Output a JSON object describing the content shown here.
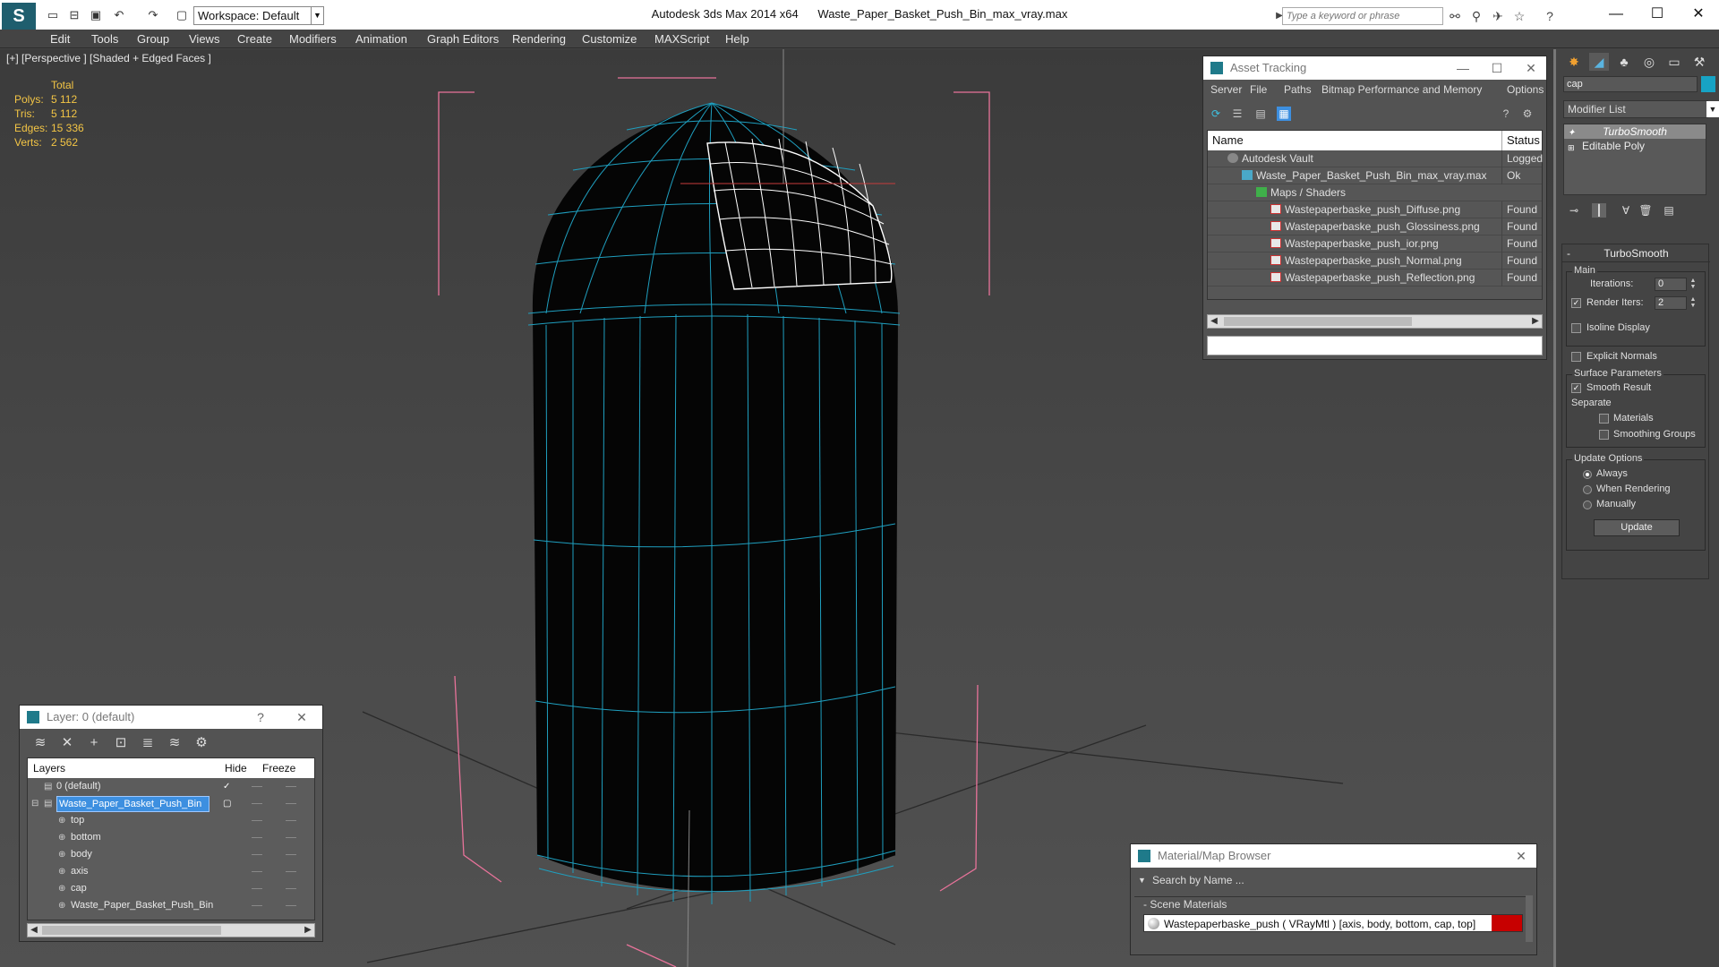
{
  "titlebar": {
    "app_title": "Autodesk 3ds Max  2014 x64",
    "file_title": "Waste_Paper_Basket_Push_Bin_max_vray.max",
    "workspace": "Workspace: Default",
    "search_placeholder": "Type a keyword or phrase"
  },
  "menu": [
    "Edit",
    "Tools",
    "Group",
    "Views",
    "Create",
    "Modifiers",
    "Animation",
    "Graph Editors",
    "Rendering",
    "Customize",
    "MAXScript",
    "Help"
  ],
  "viewport": {
    "label": "[+] [Perspective ] [Shaded + Edged Faces ]",
    "stats_header": "Total",
    "stats": [
      {
        "k": "Polys:",
        "v": "5 112"
      },
      {
        "k": "Tris:",
        "v": "5 112"
      },
      {
        "k": "Edges:",
        "v": "15 336"
      },
      {
        "k": "Verts:",
        "v": "2 562"
      }
    ]
  },
  "asset_tracking": {
    "title": "Asset Tracking",
    "menu": [
      "Server",
      "File",
      "Paths",
      "Bitmap Performance and Memory",
      "Options"
    ],
    "col_name": "Name",
    "col_status": "Status",
    "rows": [
      {
        "name": "Autodesk Vault",
        "status": "Logged Out",
        "indent": 1,
        "icon": "vault"
      },
      {
        "name": "Waste_Paper_Basket_Push_Bin_max_vray.max",
        "status": "Ok",
        "indent": 2,
        "icon": "max"
      },
      {
        "name": "Maps / Shaders",
        "status": "",
        "indent": 3,
        "icon": "maps"
      },
      {
        "name": "Wastepaperbaske_push_Diffuse.png",
        "status": "Found",
        "indent": 4,
        "icon": "png"
      },
      {
        "name": "Wastepaperbaske_push_Glossiness.png",
        "status": "Found",
        "indent": 4,
        "icon": "png"
      },
      {
        "name": "Wastepaperbaske_push_ior.png",
        "status": "Found",
        "indent": 4,
        "icon": "png"
      },
      {
        "name": "Wastepaperbaske_push_Normal.png",
        "status": "Found",
        "indent": 4,
        "icon": "png"
      },
      {
        "name": "Wastepaperbaske_push_Reflection.png",
        "status": "Found",
        "indent": 4,
        "icon": "png"
      }
    ]
  },
  "command_panel": {
    "object_name": "cap",
    "object_color": "#17a3c4",
    "modifier_list": "Modifier List",
    "stack": [
      "TurboSmooth",
      "Editable Poly"
    ],
    "turbosmooth": {
      "title": "TurboSmooth",
      "main_label": "Main",
      "iterations_label": "Iterations:",
      "iterations_value": "0",
      "render_iters_label": "Render Iters:",
      "render_iters_value": "2",
      "isoline_label": "Isoline Display",
      "explicit_normals_label": "Explicit Normals",
      "surface_label": "Surface Parameters",
      "smooth_result_label": "Smooth Result",
      "separate_label": "Separate",
      "materials_label": "Materials",
      "smoothing_groups_label": "Smoothing Groups",
      "update_options_label": "Update Options",
      "always_label": "Always",
      "when_rendering_label": "When Rendering",
      "manually_label": "Manually",
      "update_button": "Update"
    }
  },
  "layers": {
    "title": "Layer: 0 (default)",
    "col_layers": "Layers",
    "col_hide": "Hide",
    "col_freeze": "Freeze",
    "rows": [
      {
        "name": "0 (default)",
        "indent": 1,
        "selected": false
      },
      {
        "name": "Waste_Paper_Basket_Push_Bin",
        "indent": 1,
        "selected": true
      },
      {
        "name": "top",
        "indent": 2,
        "selected": false
      },
      {
        "name": "bottom",
        "indent": 2,
        "selected": false
      },
      {
        "name": "body",
        "indent": 2,
        "selected": false
      },
      {
        "name": "axis",
        "indent": 2,
        "selected": false
      },
      {
        "name": "cap",
        "indent": 2,
        "selected": false
      },
      {
        "name": "Waste_Paper_Basket_Push_Bin",
        "indent": 2,
        "selected": false
      }
    ]
  },
  "material_browser": {
    "title": "Material/Map Browser",
    "search_placeholder": "Search by Name ...",
    "group": "Scene Materials",
    "item": "Wastepaperbaske_push ( VRayMtl ) [axis, body, bottom, cap, top]",
    "swatch_color": "#c70000"
  }
}
